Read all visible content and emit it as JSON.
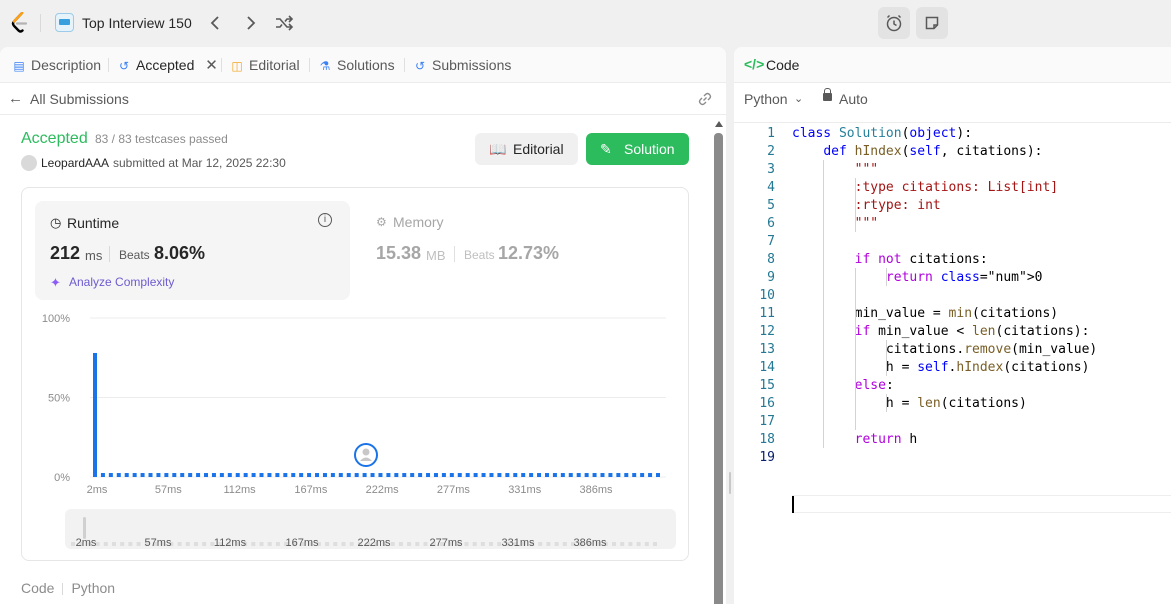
{
  "topbar": {
    "problem_list_title": "Top Interview 150",
    "prev_icon": "chevron-left",
    "next_icon": "chevron-right",
    "shuffle_icon": "shuffle",
    "alarm_icon": "alarm-clock",
    "note_icon": "note"
  },
  "tabs": [
    {
      "label": "Description",
      "icon": "doc"
    },
    {
      "label": "Accepted",
      "icon": "history",
      "active": true
    },
    {
      "label": "Editorial",
      "icon": "book"
    },
    {
      "label": "Solutions",
      "icon": "flask"
    },
    {
      "label": "Submissions",
      "icon": "history"
    }
  ],
  "submission": {
    "back_label": "All Submissions",
    "status": "Accepted",
    "testcases": "83 / 83 testcases passed",
    "user": "LeopardAAA",
    "submitted_at": "submitted at Mar 12, 2025 22:30",
    "editorial_btn": "Editorial",
    "solution_btn": "Solution"
  },
  "runtime": {
    "title": "Runtime",
    "value": "212",
    "unit": "ms",
    "beats_label": "Beats",
    "beats_value": "8.06%",
    "analyze_label": "Analyze Complexity"
  },
  "memory": {
    "title": "Memory",
    "value": "15.38",
    "unit": "MB",
    "beats_label": "Beats",
    "beats_value": "12.73%"
  },
  "chart_data": {
    "type": "bar",
    "title": "",
    "xlabel": "",
    "ylabel": "",
    "ylim": [
      0,
      100
    ],
    "y_ticks": [
      "100%",
      "50%",
      "0%"
    ],
    "x_ticks": [
      "2ms",
      "57ms",
      "112ms",
      "167ms",
      "222ms",
      "277ms",
      "331ms",
      "386ms"
    ],
    "bar_count": 72,
    "values": [
      78,
      2.5,
      2.5,
      2.5,
      2.5,
      2.5,
      2.5,
      2.5,
      2.5,
      2.5,
      2.5,
      2.5,
      2.5,
      2.5,
      2.5,
      2.5,
      2.5,
      2.5,
      2.5,
      2.5,
      2.5,
      2.5,
      2.5,
      2.5,
      2.5,
      2.5,
      2.5,
      2.5,
      2.5,
      2.5,
      2.5,
      2.5,
      2.5,
      2.5,
      2.5,
      2.5,
      2.5,
      2.5,
      2.5,
      2.5,
      2.5,
      2.5,
      2.5,
      2.5,
      2.5,
      2.5,
      2.5,
      2.5,
      2.5,
      2.5,
      2.5,
      2.5,
      2.5,
      2.5,
      2.5,
      2.5,
      2.5,
      2.5,
      2.5,
      2.5,
      2.5,
      2.5,
      2.5,
      2.5,
      2.5,
      2.5,
      2.5,
      2.5,
      2.5,
      2.5,
      2.5,
      2.5
    ],
    "user_marker_ms": 212,
    "grid": true,
    "color": "#1a73e8"
  },
  "footer": {
    "code_label": "Code",
    "lang_label": "Python"
  },
  "code_panel": {
    "tab_label": "Code",
    "language": "Python",
    "mode": "Auto",
    "lines": [
      "class Solution(object):",
      "    def hIndex(self, citations):",
      "        \"\"\"",
      "        :type citations: List[int]",
      "        :rtype: int",
      "        \"\"\"",
      "",
      "        if not citations:",
      "            return 0",
      "",
      "        min_value = min(citations)",
      "        if min_value < len(citations):",
      "            citations.remove(min_value)",
      "            h = self.hIndex(citations)",
      "        else:",
      "            h = len(citations)",
      "",
      "        return h",
      ""
    ]
  }
}
